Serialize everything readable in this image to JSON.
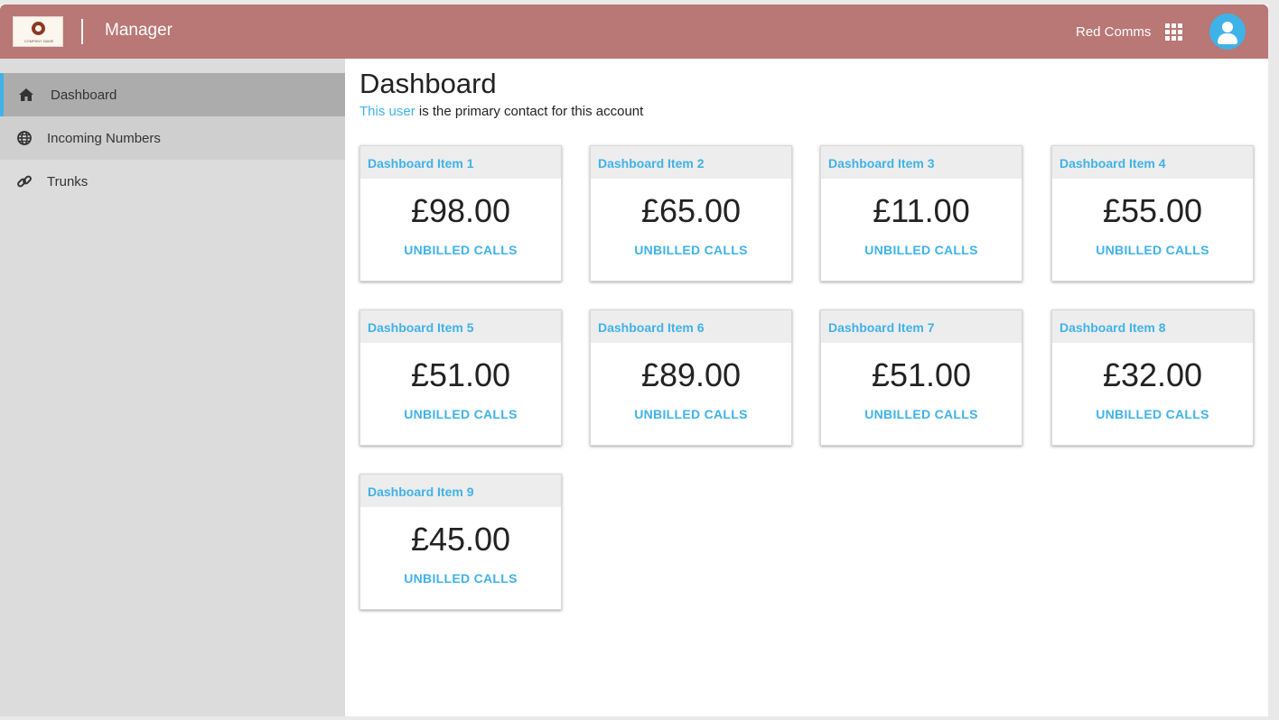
{
  "header": {
    "logo_text": "COMPANY NAME",
    "app_title": "Manager",
    "org_name": "Red Comms",
    "brand_color": "#b97775",
    "accent_color": "#3fb2e8"
  },
  "sidebar": {
    "items": [
      {
        "label": "Dashboard",
        "icon": "home-icon",
        "active": true
      },
      {
        "label": "Incoming Numbers",
        "icon": "globe-icon",
        "active": false
      },
      {
        "label": "Trunks",
        "icon": "link-icon",
        "active": false
      }
    ]
  },
  "main": {
    "title": "Dashboard",
    "subtitle_link": "This user",
    "subtitle_rest": " is the primary contact for this account",
    "cards": [
      {
        "title": "Dashboard Item 1",
        "value": "£98.00",
        "link": "UNBILLED CALLS"
      },
      {
        "title": "Dashboard Item 2",
        "value": "£65.00",
        "link": "UNBILLED CALLS"
      },
      {
        "title": "Dashboard Item 3",
        "value": "£11.00",
        "link": "UNBILLED CALLS"
      },
      {
        "title": "Dashboard Item 4",
        "value": "£55.00",
        "link": "UNBILLED CALLS"
      },
      {
        "title": "Dashboard Item 5",
        "value": "£51.00",
        "link": "UNBILLED CALLS"
      },
      {
        "title": "Dashboard Item 6",
        "value": "£89.00",
        "link": "UNBILLED CALLS"
      },
      {
        "title": "Dashboard Item 7",
        "value": "£51.00",
        "link": "UNBILLED CALLS"
      },
      {
        "title": "Dashboard Item 8",
        "value": "£32.00",
        "link": "UNBILLED CALLS"
      },
      {
        "title": "Dashboard Item 9",
        "value": "£45.00",
        "link": "UNBILLED CALLS"
      }
    ]
  }
}
